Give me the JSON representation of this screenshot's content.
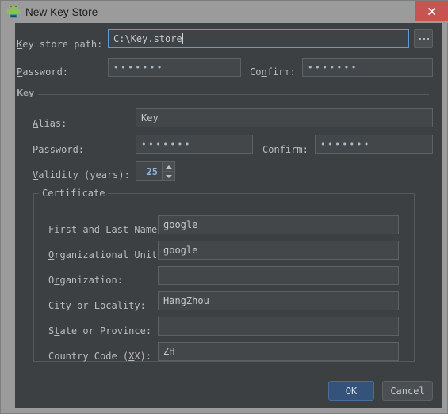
{
  "window": {
    "title": "New Key Store",
    "app_icon": "android-icon",
    "close_label": "x"
  },
  "keystore": {
    "path_label_pre": "",
    "path_label_mnemonic": "K",
    "path_label_post": "ey store path:",
    "path_value": "C:\\Key.store",
    "browse_label": "...",
    "password_label_mnemonic": "P",
    "password_label_post": "assword:",
    "password_value": "•••••••",
    "confirm_label_pre": "Co",
    "confirm_label_mnemonic": "n",
    "confirm_label_post": "firm:",
    "confirm_value": "•••••••"
  },
  "key_group": {
    "title": "Key",
    "alias_label_mnemonic": "A",
    "alias_label_post": "lias:",
    "alias_value": "Key",
    "password_label_pre": "Pa",
    "password_label_mnemonic": "s",
    "password_label_post": "sword:",
    "password_value": "•••••••",
    "confirm_label_mnemonic": "C",
    "confirm_label_post": "onfirm:",
    "confirm_value": "•••••••",
    "validity_label_mnemonic": "V",
    "validity_label_post": "alidity (years):",
    "validity_value": "25"
  },
  "certificate": {
    "title": "Certificate",
    "fields": [
      {
        "label_pre": "",
        "label_mnemonic": "F",
        "label_post": "irst and Last Name:",
        "value": "google"
      },
      {
        "label_pre": "",
        "label_mnemonic": "O",
        "label_post": "rganizational Unit:",
        "value": "google"
      },
      {
        "label_pre": "O",
        "label_mnemonic": "r",
        "label_post": "ganization:",
        "value": ""
      },
      {
        "label_pre": "City or ",
        "label_mnemonic": "L",
        "label_post": "ocality:",
        "value": "HangZhou"
      },
      {
        "label_pre": "S",
        "label_mnemonic": "t",
        "label_post": "ate or Province:",
        "value": ""
      },
      {
        "label_pre": "Country Code (",
        "label_mnemonic": "X",
        "label_post": "X):",
        "value": "ZH"
      }
    ]
  },
  "footer": {
    "ok_label": "OK",
    "cancel_label": "Cancel"
  },
  "colors": {
    "panel_bg": "#3c4042",
    "titlebar_bg": "#9b9b9b",
    "close_red": "#c75450",
    "focus_blue": "#5c9bd6",
    "default_button_blue": "#35537a",
    "android_green": "#8bc34a"
  }
}
